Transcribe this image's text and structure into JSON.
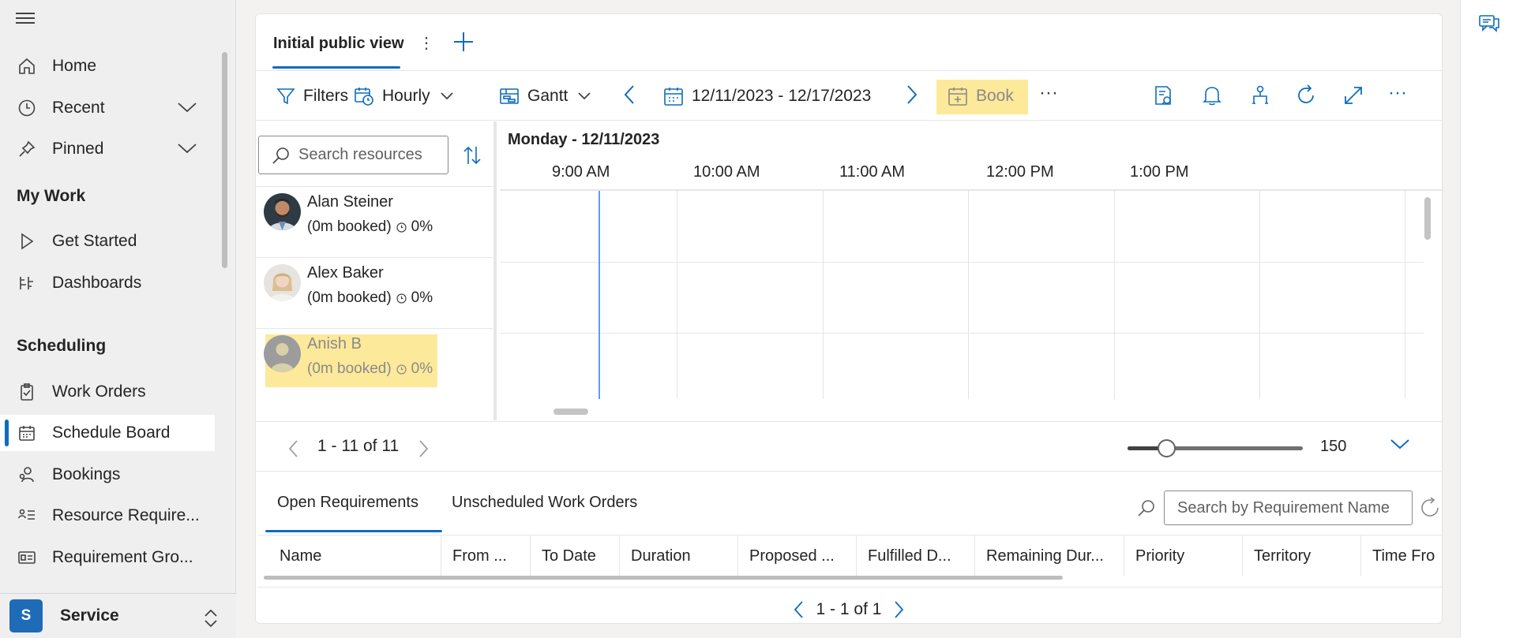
{
  "sidebar": {
    "items": [
      {
        "label": "Home",
        "icon": "home-icon"
      },
      {
        "label": "Recent",
        "icon": "clock-icon"
      },
      {
        "label": "Pinned",
        "icon": "pin-icon"
      },
      {
        "label": "Get Started",
        "icon": "play-icon"
      },
      {
        "label": "Dashboards",
        "icon": "dashboard-icon"
      },
      {
        "label": "Work Orders",
        "icon": "clipboard-icon"
      },
      {
        "label": "Schedule Board",
        "icon": "calendar-icon"
      },
      {
        "label": "Bookings",
        "icon": "people-icon"
      },
      {
        "label": "Resource Require...",
        "icon": "list-icon"
      },
      {
        "label": "Requirement Gro...",
        "icon": "card-icon"
      }
    ],
    "sections": {
      "my_work": "My Work",
      "scheduling": "Scheduling"
    },
    "area": {
      "badge": "S",
      "label": "Service"
    }
  },
  "tabs": {
    "active": "Initial public view",
    "more": "⋮"
  },
  "toolbar": {
    "filters": "Filters",
    "hourly": "Hourly",
    "gantt": "Gantt",
    "date_range": "12/11/2023 - 12/17/2023",
    "book": "Book",
    "more": "···",
    "overflow": "···"
  },
  "resources": {
    "search_placeholder": "Search resources",
    "rows": [
      {
        "name": "Alan Steiner",
        "booked": "(0m booked)",
        "pct": "0%"
      },
      {
        "name": "Alex Baker",
        "booked": "(0m booked)",
        "pct": "0%"
      },
      {
        "name": "Anish B",
        "booked": "(0m booked)",
        "pct": "0%"
      }
    ]
  },
  "gantt": {
    "day": "Monday - 12/11/2023",
    "hours": [
      "9:00 AM",
      "10:00 AM",
      "11:00 AM",
      "12:00 PM",
      "1:00 PM"
    ]
  },
  "pager": {
    "text": "1 - 11 of 11"
  },
  "zoom": {
    "value": "150",
    "fraction": 0.22
  },
  "requirements": {
    "tabs": [
      "Open Requirements",
      "Unscheduled Work Orders"
    ],
    "search_placeholder": "Search by Requirement Name",
    "columns": [
      "Name",
      "From ...",
      "To Date",
      "Duration",
      "Proposed ...",
      "Fulfilled D...",
      "Remaining Dur...",
      "Priority",
      "Territory",
      "Time Fro"
    ],
    "pager": "1 - 1 of 1"
  },
  "colors": {
    "accent": "#0f6cbd",
    "highlight": "#fde99a",
    "area_badge": "#1e6bb8"
  }
}
